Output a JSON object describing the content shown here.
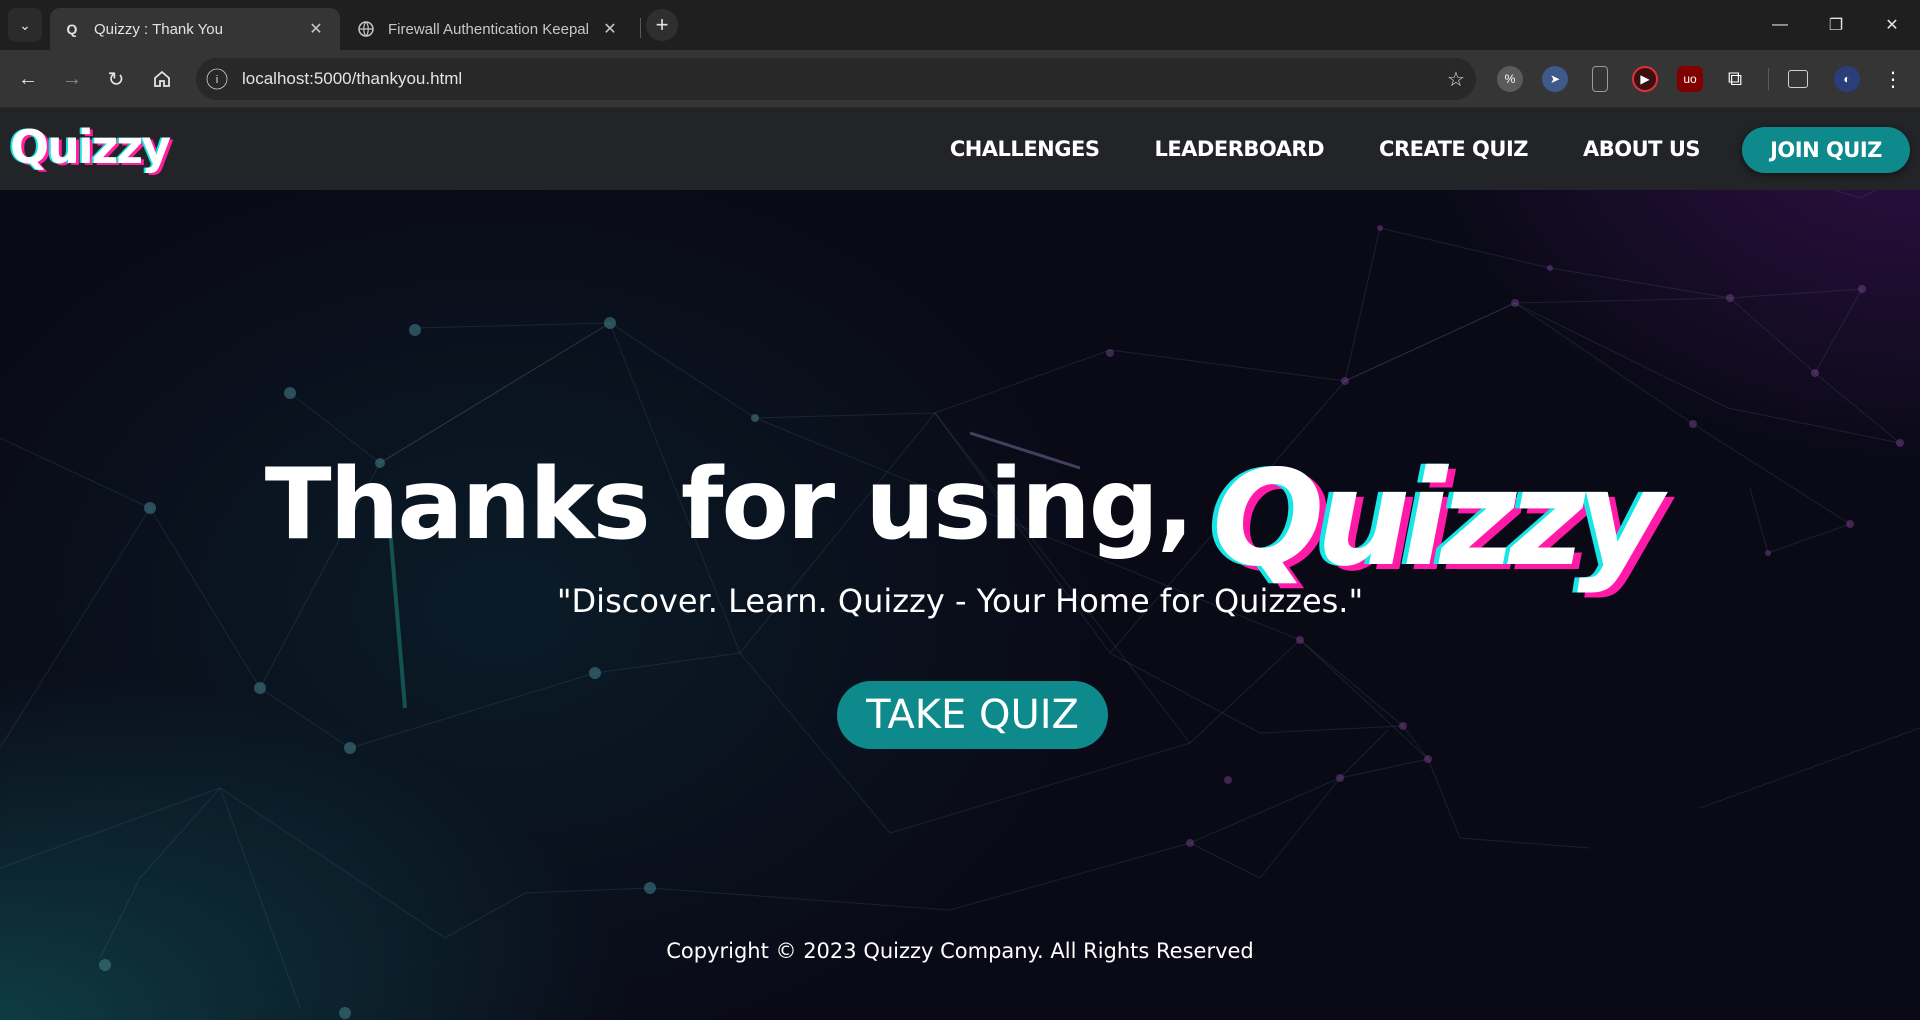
{
  "browser": {
    "tabs": [
      {
        "title": "Quizzy : Thank You",
        "favicon": "Q",
        "active": true
      },
      {
        "title": "Firewall Authentication Keepal",
        "favicon": "globe-icon",
        "active": false
      }
    ],
    "url": "localhost:5000/thankyou.html"
  },
  "site": {
    "logo": "Quizzy",
    "nav": [
      "CHALLENGES",
      "LEADERBOARD",
      "CREATE QUIZ",
      "ABOUT US"
    ],
    "join_label": "JOIN QUIZ"
  },
  "hero": {
    "title_prefix": "Thanks for using,",
    "brand": "Quizzy",
    "tagline": "\"Discover. Learn. Quizzy - Your Home for Quizzes.\"",
    "cta_label": "TAKE QUIZ"
  },
  "footer": {
    "copyright": "Copyright © 2023 Quizzy Company. All Rights Reserved"
  },
  "colors": {
    "accent": "#0f8a8c",
    "cyan_shadow": "#18e6e6",
    "magenta_shadow": "#ff1aa8",
    "nav_bg": "#232427"
  }
}
